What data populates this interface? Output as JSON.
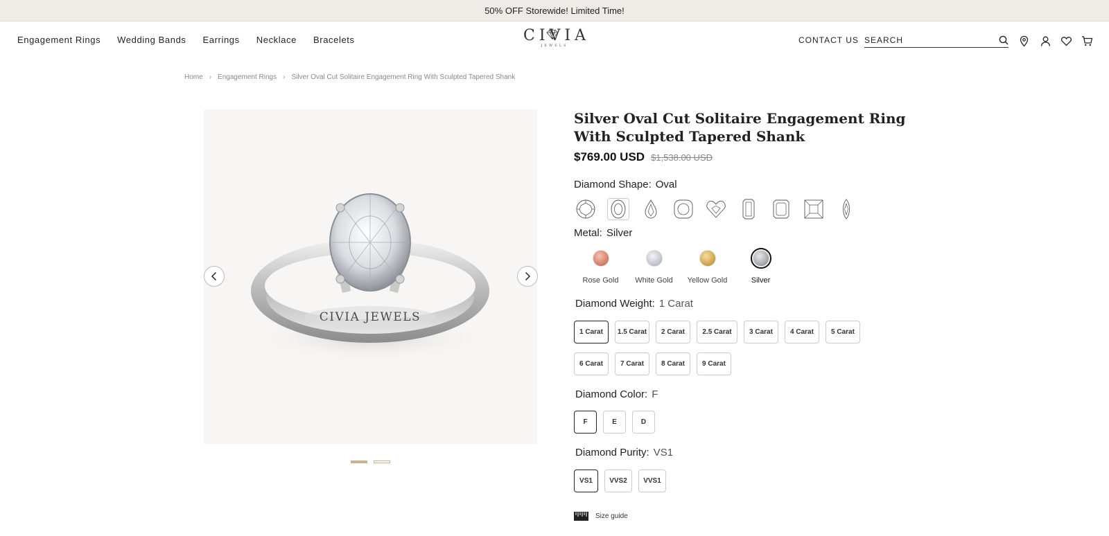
{
  "announcement": "50% OFF Storewide! Limited Time!",
  "nav": [
    "Engagement Rings",
    "Wedding Bands",
    "Earrings",
    "Necklace",
    "Bracelets"
  ],
  "logo": {
    "word": "CIVIA",
    "sub": "JEWELS"
  },
  "header": {
    "contact": "CONTACT US",
    "search_placeholder": "SEARCH"
  },
  "icons": [
    "search-icon",
    "location-pin-icon",
    "user-icon",
    "heart-icon",
    "cart-icon"
  ],
  "breadcrumb": [
    "Home",
    "Engagement Rings",
    "Silver Oval Cut Solitaire Engagement Ring With Sculpted Tapered Shank"
  ],
  "product": {
    "title": "Silver Oval Cut Solitaire Engagement Ring With Sculpted Tapered Shank",
    "price": "$769.00 USD",
    "compare_price": "$1,538.00 USD",
    "image_engraving": "CIVIA JEWELS",
    "gallery_count": 2,
    "gallery_active": 1
  },
  "shape": {
    "label": "Diamond Shape:",
    "value": "Oval",
    "options": [
      "round",
      "oval",
      "pear",
      "cushion",
      "heart",
      "emerald",
      "radiant",
      "princess",
      "marquise"
    ],
    "selected": "oval"
  },
  "metal": {
    "label": "Metal:",
    "value": "Silver",
    "options": [
      {
        "name": "Rose Gold",
        "color": "#d9826c"
      },
      {
        "name": "White Gold",
        "color": "#c4c9cf"
      },
      {
        "name": "Yellow Gold",
        "color": "#d3a84e"
      },
      {
        "name": "Silver",
        "color": "#a9adb2"
      }
    ],
    "selected": "Silver"
  },
  "weight": {
    "label": "Diamond Weight:",
    "value": "1 Carat",
    "options": [
      "1 Carat",
      "1.5 Carat",
      "2 Carat",
      "2.5 Carat",
      "3 Carat",
      "4 Carat",
      "5 Carat",
      "6 Carat",
      "7 Carat",
      "8 Carat",
      "9 Carat"
    ],
    "selected": "1 Carat"
  },
  "color": {
    "label": "Diamond Color:",
    "value": "F",
    "options": [
      "F",
      "E",
      "D"
    ],
    "selected": "F"
  },
  "purity": {
    "label": "Diamond Purity:",
    "value": "VS1",
    "options": [
      "VS1",
      "VVS2",
      "VVS1"
    ],
    "selected": "VS1"
  },
  "size_guide": "Size guide",
  "colors": {
    "announce_bg": "#efece7",
    "dot_active": "#c9b48a",
    "text": "#222222"
  }
}
